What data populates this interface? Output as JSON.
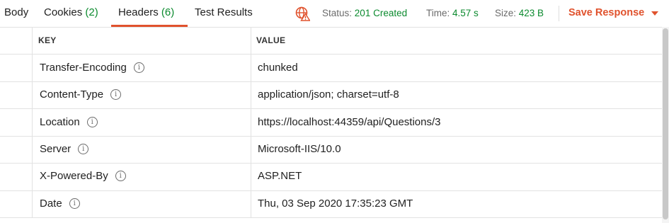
{
  "tabs": [
    {
      "label": "Body",
      "count": ""
    },
    {
      "label": "Cookies",
      "count": "(2)"
    },
    {
      "label": "Headers",
      "count": "(6)"
    },
    {
      "label": "Test Results",
      "count": ""
    }
  ],
  "active_tab": "Headers",
  "status": {
    "status_label": "Status:",
    "status_value": "201 Created",
    "time_label": "Time:",
    "time_value": "4.57 s",
    "size_label": "Size:",
    "size_value": "423 B"
  },
  "save_response_label": "Save Response",
  "table": {
    "columns": [
      "KEY",
      "VALUE"
    ],
    "rows": [
      {
        "key": "Transfer-Encoding",
        "value": "chunked"
      },
      {
        "key": "Content-Type",
        "value": "application/json; charset=utf-8"
      },
      {
        "key": "Location",
        "value": "https://localhost:44359/api/Questions/3"
      },
      {
        "key": "Server",
        "value": "Microsoft-IIS/10.0"
      },
      {
        "key": "X-Powered-By",
        "value": "ASP.NET"
      },
      {
        "key": "Date",
        "value": "Thu, 03 Sep 2020 17:35:23 GMT"
      }
    ]
  },
  "colors": {
    "accent": "#e0522d",
    "success": "#0b8a2e"
  }
}
